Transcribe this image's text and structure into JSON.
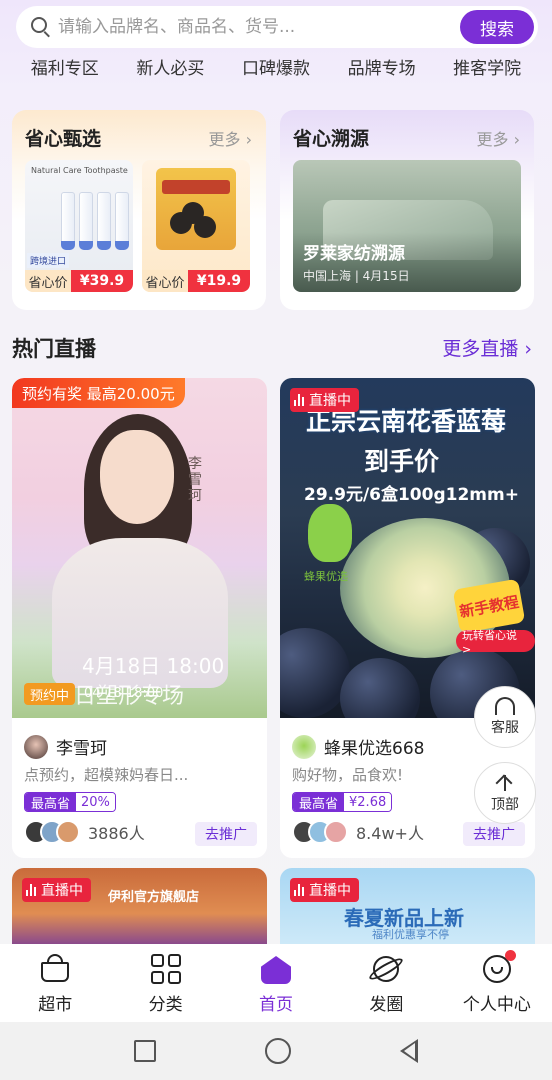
{
  "search": {
    "placeholder": "请输入品牌名、商品名、货号...",
    "button": "搜索"
  },
  "categories": [
    "福利专区",
    "新人必买",
    "口碑爆款",
    "品牌专场",
    "推客学院"
  ],
  "feature_left": {
    "title": "省心甄选",
    "more": "更多 ›",
    "products": [
      {
        "price_label": "省心价",
        "price": "¥39.9",
        "tag": "跨境进口",
        "box_text": "Natural Care Toothpaste"
      },
      {
        "price_label": "省心价",
        "price": "¥19.9"
      }
    ]
  },
  "feature_right": {
    "title": "省心溯源",
    "more": "更多 ›",
    "caption": "罗莱家纺溯源",
    "location": "中国上海 | 4月15日"
  },
  "live_section": {
    "title": "热门直播",
    "more": "更多直播 ›"
  },
  "live_cards": [
    {
      "promo": "预约有奖 最高20.00元",
      "name_overlay": "李雪珂",
      "date_overlay": "4月18日 18:00",
      "sub_overlay": "春日塑形专场",
      "status": "预约中",
      "time": "04-18 18:00",
      "anchor": "李雪珂",
      "desc": "点预约，超模辣妈春日...",
      "save_label": "最高省",
      "save_value": "20%",
      "viewers": "3886人",
      "promote": "去推广"
    },
    {
      "status": "直播中",
      "headline1": "正宗云南花香蓝莓",
      "headline2": "到手价",
      "headline3": "29.9元/6盒100g12mm+",
      "brand_overlay": "蜂果优选",
      "tutorial": "新手教程",
      "tutorial_sub": "玩转省心说 >",
      "anchor": "蜂果优选668",
      "desc": "购好物，品食欢!",
      "save_label": "最高省",
      "save_value": "¥2.68",
      "viewers": "8.4w+人",
      "promote": "去推广"
    }
  ],
  "peek_cards": [
    {
      "status": "直播中",
      "store": "伊利官方旗舰店"
    },
    {
      "status": "直播中",
      "title": "春夏新品上新",
      "subtitle": "福利优惠享不停"
    }
  ],
  "float_buttons": {
    "service": "客服",
    "top": "顶部"
  },
  "tabbar": [
    {
      "label": "超市",
      "icon": "basket-icon"
    },
    {
      "label": "分类",
      "icon": "grid-icon"
    },
    {
      "label": "首页",
      "icon": "home-icon",
      "active": true
    },
    {
      "label": "发圈",
      "icon": "planet-icon"
    },
    {
      "label": "个人中心",
      "icon": "smile-icon"
    }
  ],
  "colors": {
    "accent": "#7b2fd6",
    "price_red": "#f0323f",
    "live_red": "#e8243d"
  }
}
